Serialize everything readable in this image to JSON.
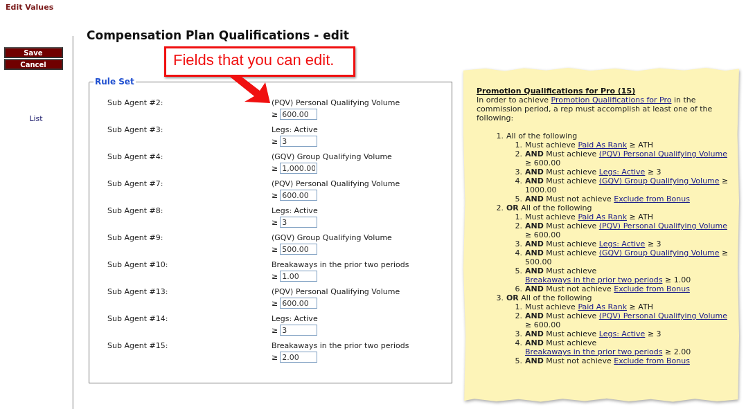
{
  "header": {
    "title": "Edit Values"
  },
  "sidebar": {
    "buttons": [
      "Save",
      "Cancel"
    ],
    "link": "List"
  },
  "page_title": "Compensation Plan Qualifications - edit",
  "callout": {
    "text": "Fields that you can edit."
  },
  "rule_set": {
    "legend": "Rule Set",
    "rows": [
      {
        "label": "Sub Agent #2:",
        "measure": "(PQV) Personal Qualifying Volume",
        "operator": "≥",
        "value": "600.00"
      },
      {
        "label": "Sub Agent #3:",
        "measure": "Legs: Active",
        "operator": "≥",
        "value": "3"
      },
      {
        "label": "Sub Agent #4:",
        "measure": "(GQV) Group Qualifying Volume",
        "operator": "≥",
        "value": "1,000.00"
      },
      {
        "label": "Sub Agent #7:",
        "measure": "(PQV) Personal Qualifying Volume",
        "operator": "≥",
        "value": "600.00"
      },
      {
        "label": "Sub Agent #8:",
        "measure": "Legs: Active",
        "operator": "≥",
        "value": "3"
      },
      {
        "label": "Sub Agent #9:",
        "measure": "(GQV) Group Qualifying Volume",
        "operator": "≥",
        "value": "500.00"
      },
      {
        "label": "Sub Agent #10:",
        "measure": "Breakaways in the prior two periods",
        "operator": "≥",
        "value": "1.00"
      },
      {
        "label": "Sub Agent #13:",
        "measure": "(PQV) Personal Qualifying Volume",
        "operator": "≥",
        "value": "600.00"
      },
      {
        "label": "Sub Agent #14:",
        "measure": "Legs: Active",
        "operator": "≥",
        "value": "3"
      },
      {
        "label": "Sub Agent #15:",
        "measure": "Breakaways in the prior two periods",
        "operator": "≥",
        "value": "2.00"
      }
    ]
  },
  "note": {
    "title": "Promotion Qualifications for Pro (15)",
    "intro_before": "In order to achieve",
    "intro_link": "Promotion Qualifications for Pro",
    "intro_after": "in the commission period, a rep must accomplish at least one of the following:",
    "groups": [
      {
        "number": "1.",
        "text": "All of the following",
        "items": [
          {
            "number": "1.",
            "before": "Must achieve",
            "link": "Paid As Rank",
            "after": "≥ ATH"
          },
          {
            "number": "2.",
            "lead": "AND",
            "before": "Must achieve",
            "link": "(PQV) Personal Qualifying Volume",
            "after": "≥ 600.00"
          },
          {
            "number": "3.",
            "lead": "AND",
            "before": "Must achieve",
            "link": "Legs: Active",
            "after": "≥ 3"
          },
          {
            "number": "4.",
            "lead": "AND",
            "before": "Must achieve",
            "link": "(GQV) Group Qualifying Volume",
            "after": "≥ 1000.00"
          },
          {
            "number": "5.",
            "lead": "AND",
            "before": "Must not achieve",
            "link": "Exclude from Bonus"
          }
        ]
      },
      {
        "number": "2.",
        "lead": "OR",
        "text": "All of the following",
        "items": [
          {
            "number": "1.",
            "before": "Must achieve",
            "link": "Paid As Rank",
            "after": "≥ ATH"
          },
          {
            "number": "2.",
            "lead": "AND",
            "before": "Must achieve",
            "link": "(PQV) Personal Qualifying Volume",
            "after": "≥ 600.00"
          },
          {
            "number": "3.",
            "lead": "AND",
            "before": "Must achieve",
            "link": "Legs: Active",
            "after": "≥ 3"
          },
          {
            "number": "4.",
            "lead": "AND",
            "before": "Must achieve",
            "link": "(GQV) Group Qualifying Volume",
            "after": "≥ 500.00"
          },
          {
            "number": "5.",
            "lead": "AND",
            "before": "Must achieve",
            "link": "Breakaways in the prior two periods",
            "after": "≥ 1.00"
          },
          {
            "number": "6.",
            "lead": "AND",
            "before": "Must not achieve",
            "link": "Exclude from Bonus"
          }
        ]
      },
      {
        "number": "3.",
        "lead": "OR",
        "text": "All of the following",
        "items": [
          {
            "number": "1.",
            "before": "Must achieve",
            "link": "Paid As Rank",
            "after": "≥ ATH"
          },
          {
            "number": "2.",
            "lead": "AND",
            "before": "Must achieve",
            "link": "(PQV) Personal Qualifying Volume",
            "after": "≥ 600.00"
          },
          {
            "number": "3.",
            "lead": "AND",
            "before": "Must achieve",
            "link": "Legs: Active",
            "after": "≥ 3"
          },
          {
            "number": "4.",
            "lead": "AND",
            "before": "Must achieve",
            "link": "Breakaways in the prior two periods",
            "after": "≥ 2.00"
          },
          {
            "number": "5.",
            "lead": "AND",
            "before": "Must not achieve",
            "link": "Exclude from Bonus"
          }
        ]
      }
    ]
  }
}
